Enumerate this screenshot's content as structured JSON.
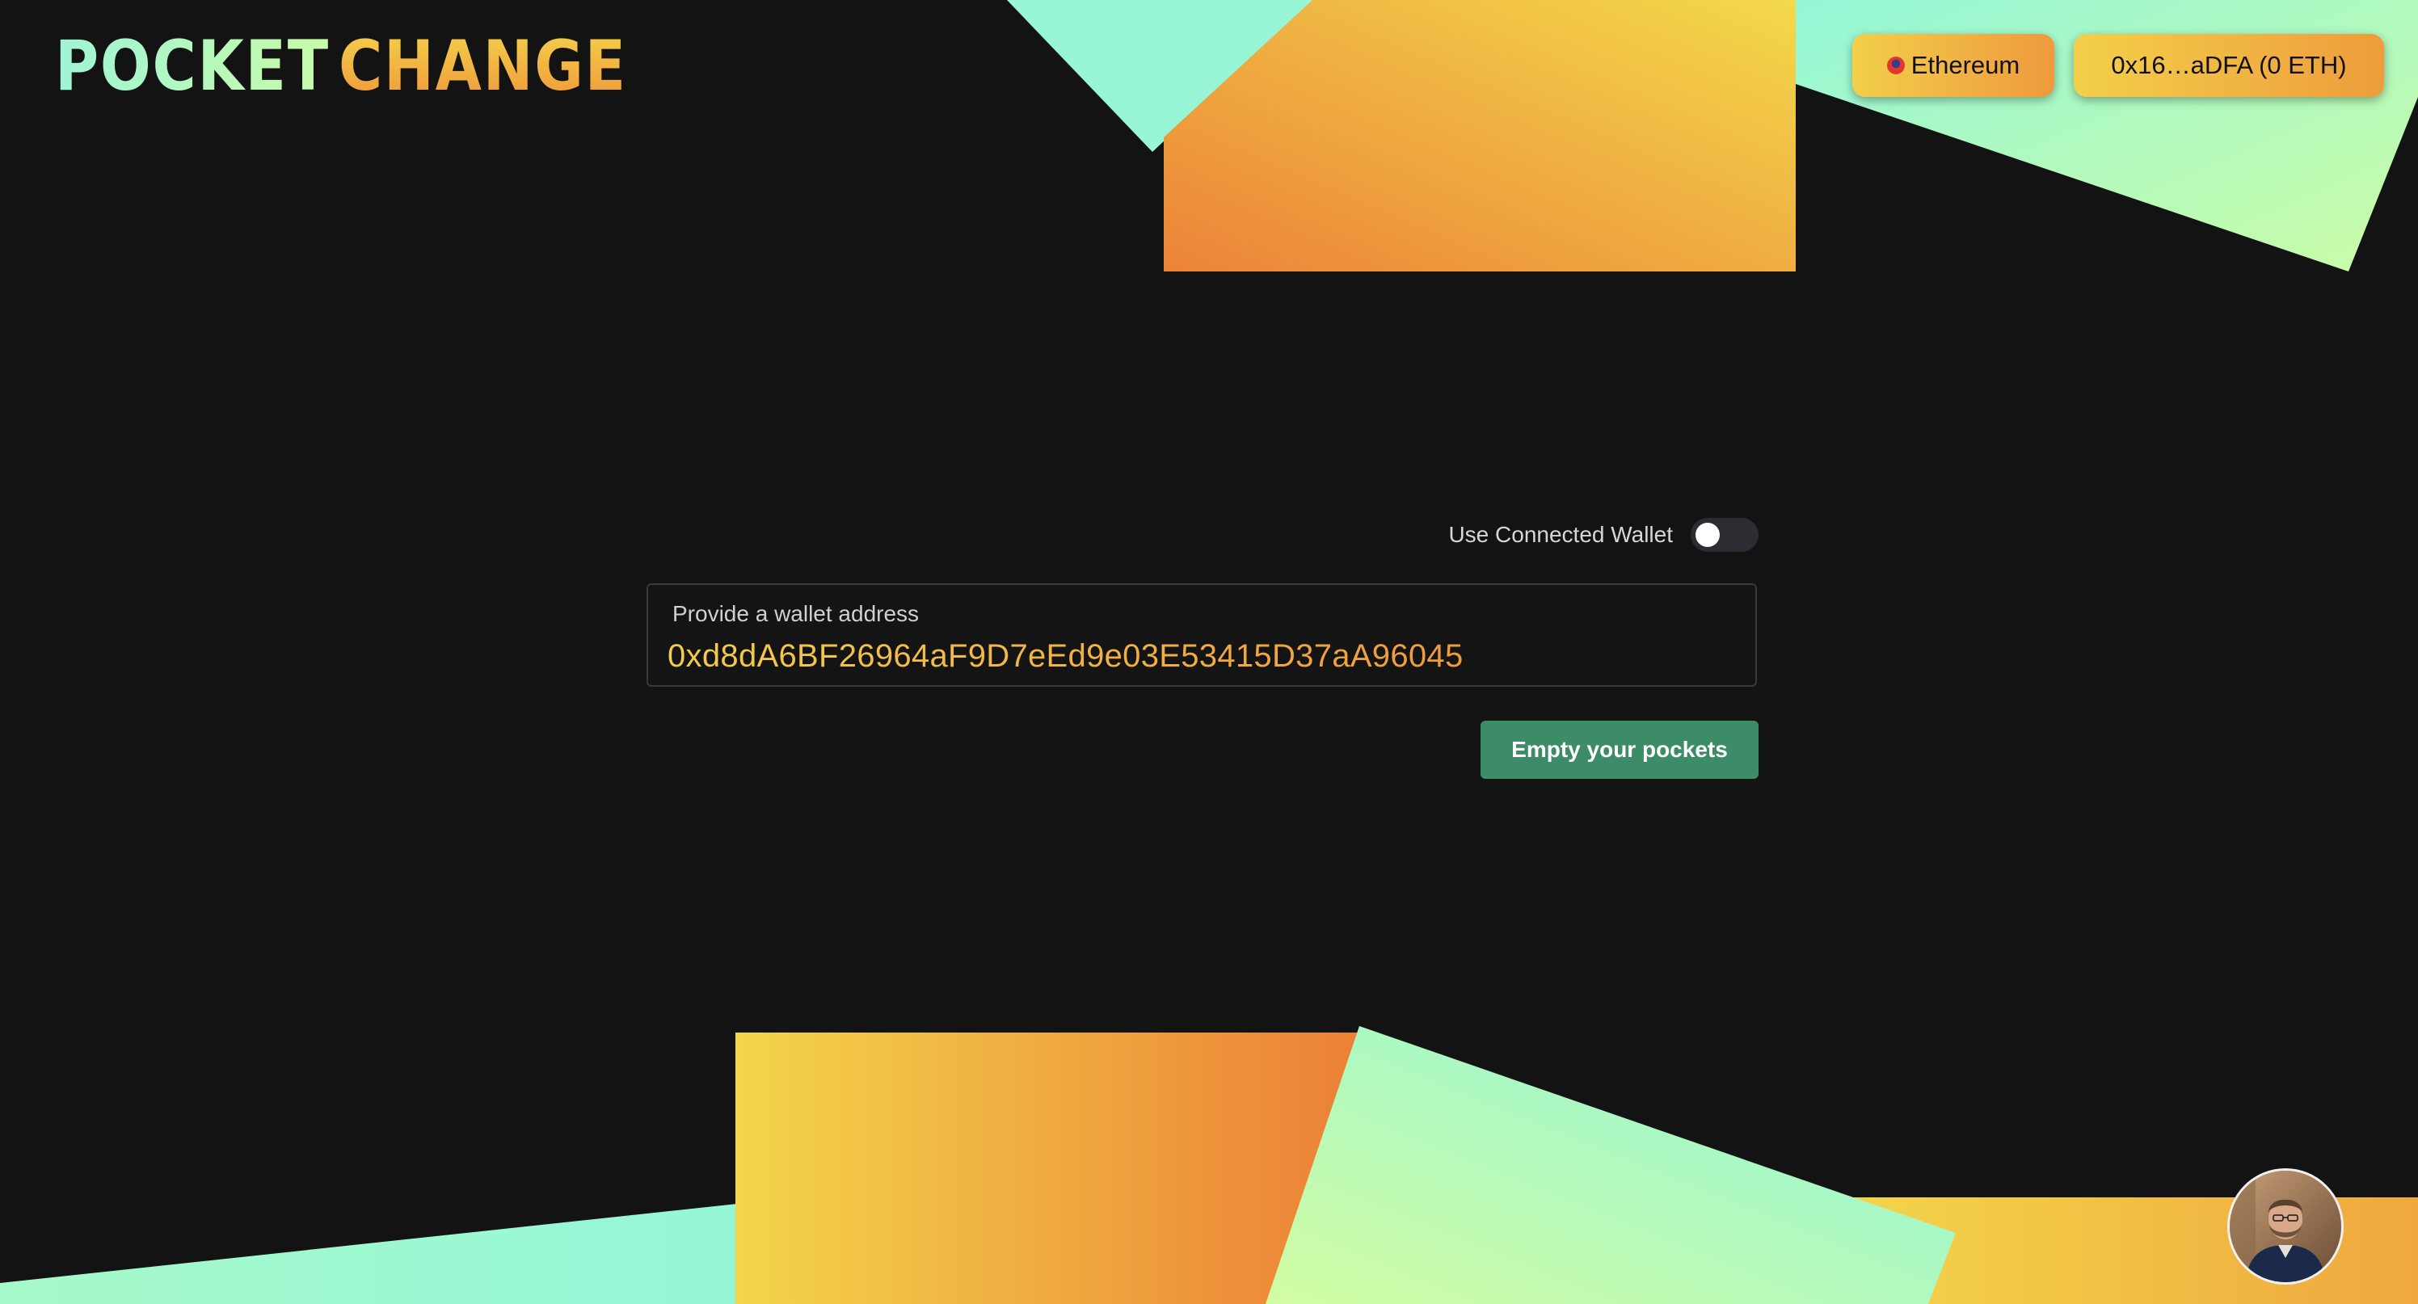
{
  "app": {
    "logo_word_1": "POCKET",
    "logo_word_2": "CHANGE"
  },
  "header": {
    "network_label": "Ethereum",
    "network_icon": "ethereum-network-icon",
    "account_label": "0x16…aDFA (0 ETH)"
  },
  "form": {
    "toggle_label": "Use Connected Wallet",
    "toggle_on": false,
    "address_label": "Provide a wallet address",
    "address_value": "0xd8dA6BF26964aF9D7eEd9e03E53415D37aA96045",
    "submit_label": "Empty your pockets"
  },
  "colors": {
    "background": "#131313",
    "accent_orange": "#ee8a38",
    "accent_yellow": "#f3d34b",
    "accent_mint": "#95f7d8",
    "accent_lime": "#c9fba5",
    "button_green": "#3d8c68"
  }
}
